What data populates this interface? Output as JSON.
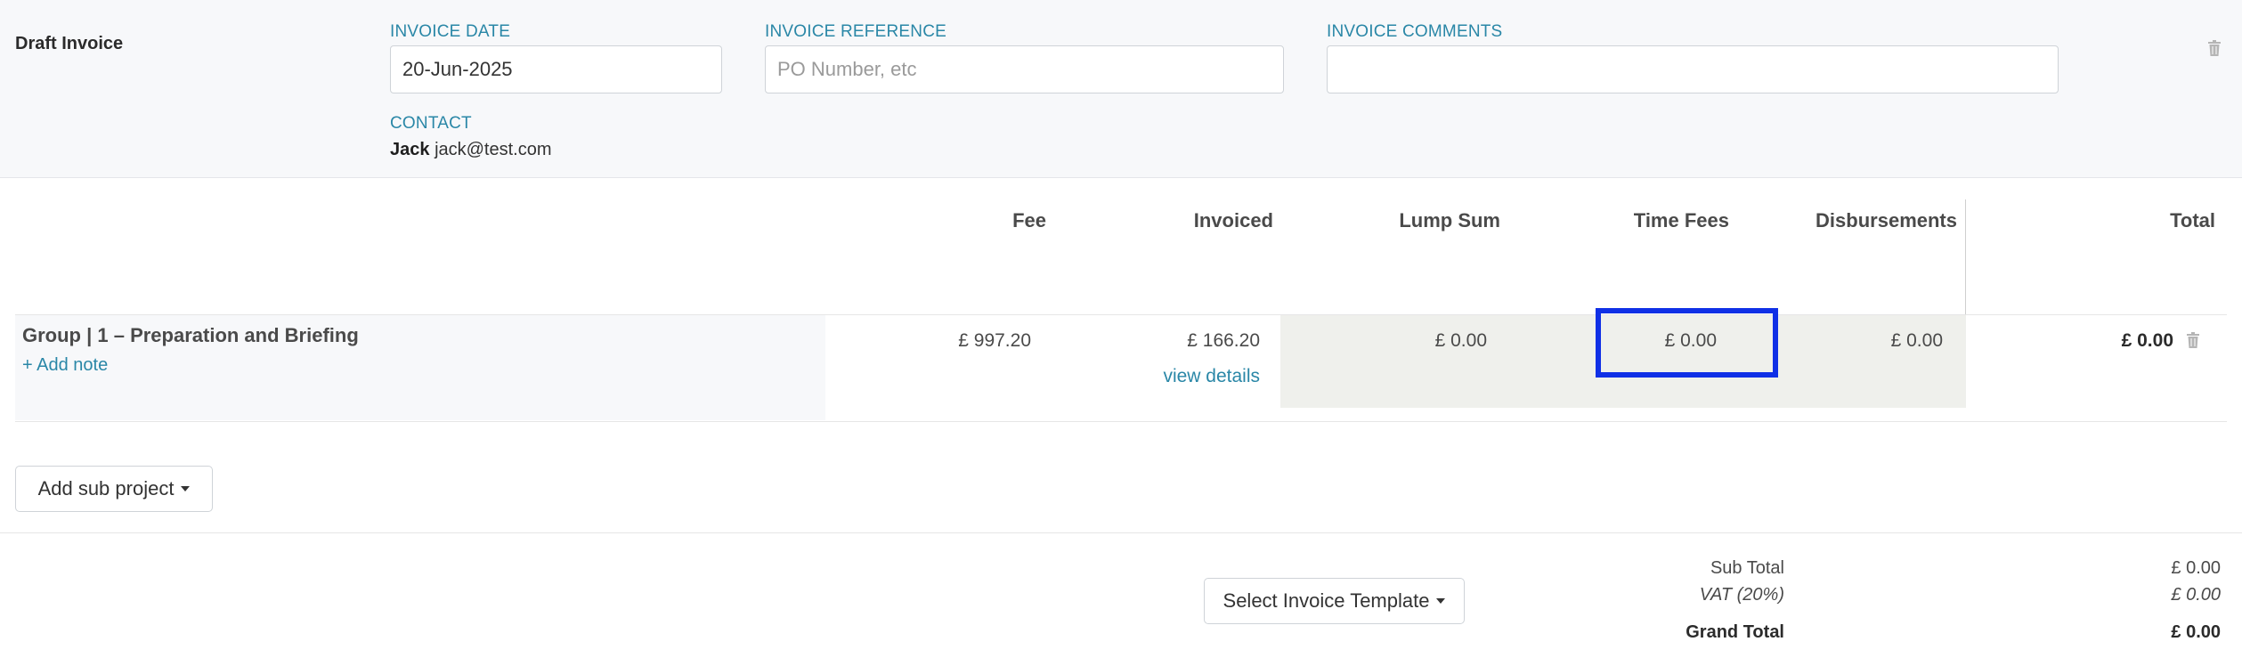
{
  "header": {
    "title": "Draft Invoice",
    "invoice_date": {
      "label": "INVOICE DATE",
      "value": "20-Jun-2025"
    },
    "invoice_reference": {
      "label": "INVOICE REFERENCE",
      "value": "",
      "placeholder": "PO Number, etc"
    },
    "invoice_comments": {
      "label": "INVOICE COMMENTS",
      "value": ""
    },
    "contact": {
      "label": "CONTACT",
      "name": "Jack",
      "email": "jack@test.com"
    }
  },
  "table": {
    "columns": [
      "Fee",
      "Invoiced",
      "Lump Sum",
      "Time Fees",
      "Disbursements",
      "Total"
    ],
    "rows": [
      {
        "title": "Group | 1 – Preparation and Briefing",
        "add_note": "+ Add note",
        "fee": "£ 997.20",
        "invoiced": "£ 166.20",
        "view_details": "view details",
        "lump_sum": "£ 0.00",
        "time_fees": "£ 0.00",
        "disbursements": "£ 0.00",
        "total": "£ 0.00"
      }
    ]
  },
  "actions": {
    "add_sub_project": "Add sub project",
    "select_invoice_template": "Select Invoice Template"
  },
  "totals": {
    "sub_total_label": "Sub Total",
    "sub_total": "£ 0.00",
    "vat_label": "VAT (20%)",
    "vat": "£ 0.00",
    "grand_total_label": "Grand Total",
    "grand_total": "£ 0.00"
  },
  "icons": {
    "header_delete": "trash-icon",
    "row_delete": "trash-icon",
    "dropdown": "caret-down-icon"
  },
  "colors": {
    "accent": "#2a87a7",
    "highlight": "#1030e6",
    "header_bg": "#f7f8fa",
    "cell_grey": "#eff0ec"
  }
}
